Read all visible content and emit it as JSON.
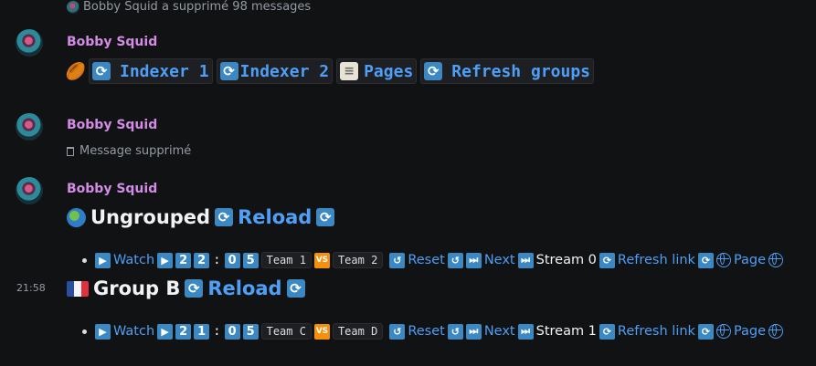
{
  "system": {
    "text": "Bobby Squid a supprimé 98 messages"
  },
  "messages": [
    {
      "author": "Bobby Squid",
      "buttons": {
        "indexer1": "Indexer 1",
        "indexer2": "Indexer 2",
        "pages": "Pages",
        "refresh_groups": "Refresh groups"
      }
    },
    {
      "author": "Bobby Squid",
      "deleted_text": "Message supprimé"
    },
    {
      "author": "Bobby Squid",
      "groups": [
        {
          "title": "Ungrouped",
          "reload": "Reload",
          "timestamp": "",
          "match": {
            "watch": "Watch",
            "time_digits": [
              "2",
              "2",
              "0",
              "5"
            ],
            "colon": ":",
            "team1": "Team 1",
            "vs": "VS",
            "team2": "Team 2",
            "reset": "Reset",
            "next": "Next",
            "stream": "Stream 0",
            "refresh_link": "Refresh link",
            "page": "Page"
          }
        },
        {
          "title": "Group B",
          "reload": "Reload",
          "timestamp": "21:58",
          "match": {
            "watch": "Watch",
            "time_digits": [
              "2",
              "1",
              "0",
              "5"
            ],
            "colon": ":",
            "team1": "Team C",
            "vs": "VS",
            "team2": "Team D",
            "reset": "Reset",
            "next": "Next",
            "stream": "Stream 1",
            "refresh_link": "Refresh link",
            "page": "Page"
          }
        }
      ]
    }
  ],
  "colors": {
    "background": "#111214",
    "author": "#d38be6",
    "link": "#4e9ff5",
    "emoji_blue": "#3b88c3",
    "emoji_orange": "#f4900c"
  },
  "icons": {
    "refresh": "🔄",
    "rugby": "🏉",
    "scroll": "📃",
    "globe": "🌍",
    "play": "▶",
    "fast_forward": "⏭",
    "return": "⤾",
    "flag_fr": "🇫🇷"
  }
}
